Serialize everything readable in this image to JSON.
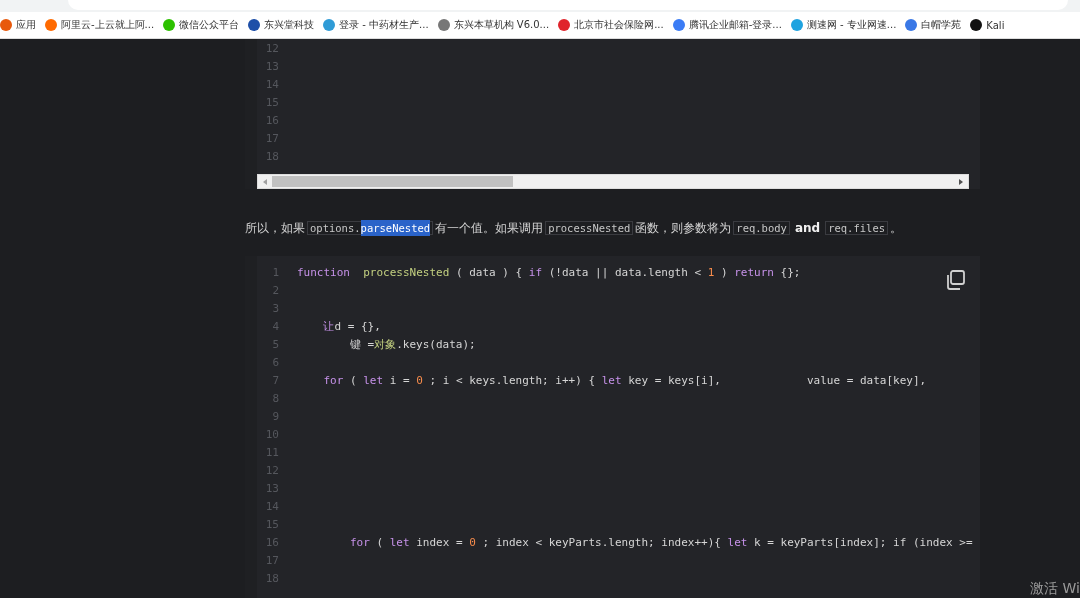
{
  "bookmarks": [
    {
      "label": "应用",
      "color": "#e8590c"
    },
    {
      "label": "阿里云-上云就上阿...",
      "color": "#ff6a00"
    },
    {
      "label": "微信公众平台",
      "color": "#2dc100"
    },
    {
      "label": "东兴堂科技",
      "color": "#1e4fa8"
    },
    {
      "label": "登录 - 中药材生产...",
      "color": "#2f9bd6"
    },
    {
      "label": "东兴本草机构 V6.0...",
      "color": "#777777"
    },
    {
      "label": "北京市社会保险网...",
      "color": "#e0242c"
    },
    {
      "label": "腾讯企业邮箱-登录...",
      "color": "#3b7cf5"
    },
    {
      "label": "测速网 - 专业网速...",
      "color": "#1fa3e0"
    },
    {
      "label": "白帽学苑",
      "color": "#3a78e6"
    },
    {
      "label": "Kali",
      "color": "#111111"
    }
  ],
  "first_code_block": {
    "line_numbers": [
      "12",
      "13",
      "14",
      "15",
      "16",
      "17",
      "18"
    ]
  },
  "paragraph": [
    {
      "kind": "text",
      "text": "所以，如果"
    },
    {
      "kind": "code",
      "parts": [
        {
          "text": "options.",
          "selected": false
        },
        {
          "text": "parseNested",
          "selected": true
        }
      ]
    },
    {
      "kind": "text",
      "text": "有一个值。如果调用"
    },
    {
      "kind": "code",
      "parts": [
        {
          "text": "processNested",
          "selected": false
        }
      ]
    },
    {
      "kind": "text",
      "text": "函数，则参数将为"
    },
    {
      "kind": "code",
      "parts": [
        {
          "text": "req.body",
          "selected": false
        }
      ]
    },
    {
      "kind": "strong",
      "text": "and"
    },
    {
      "kind": "code",
      "parts": [
        {
          "text": "req.files",
          "selected": false
        }
      ]
    },
    {
      "kind": "text",
      "text": "。"
    }
  ],
  "code_block": {
    "lines": [
      {
        "number": "1",
        "tokens": [
          {
            "kind": "keyword",
            "text": "function"
          },
          {
            "kind": "name",
            "text": "  processNested"
          },
          {
            "kind": "plain",
            "text": " ( data ) { "
          },
          {
            "kind": "keyword",
            "text": "if"
          },
          {
            "kind": "plain",
            "text": " (!data || data.length < "
          },
          {
            "kind": "number",
            "text": "1"
          },
          {
            "kind": "plain",
            "text": " ) "
          },
          {
            "kind": "keyword",
            "text": "return"
          },
          {
            "kind": "plain",
            "text": " {};"
          }
        ]
      },
      {
        "number": "2"
      },
      {
        "number": "3"
      },
      {
        "number": "4",
        "tokens": [
          {
            "kind": "keyword",
            "text": "    让"
          },
          {
            "kind": "plain",
            "text": "d = {},"
          }
        ]
      },
      {
        "number": "5",
        "tokens": [
          {
            "kind": "plain",
            "text": "        键 ="
          },
          {
            "kind": "name",
            "text": "对象"
          },
          {
            "kind": "plain",
            "text": ".keys(data);"
          }
        ]
      },
      {
        "number": "6"
      },
      {
        "number": "7",
        "tokens": [
          {
            "kind": "keyword",
            "text": "    for"
          },
          {
            "kind": "plain",
            "text": " ( "
          },
          {
            "kind": "keyword",
            "text": "let"
          },
          {
            "kind": "plain",
            "text": " i = "
          },
          {
            "kind": "number",
            "text": "0"
          },
          {
            "kind": "plain",
            "text": " ; i < keys.length; i++) { "
          },
          {
            "kind": "keyword",
            "text": "let"
          },
          {
            "kind": "plain",
            "text": " key = keys[i],             value = data[key],"
          }
        ]
      },
      {
        "number": "8"
      },
      {
        "number": "9"
      },
      {
        "number": "10"
      },
      {
        "number": "11"
      },
      {
        "number": "12"
      },
      {
        "number": "13"
      },
      {
        "number": "14"
      },
      {
        "number": "15"
      },
      {
        "number": "16",
        "tokens": [
          {
            "kind": "keyword",
            "text": "        for"
          },
          {
            "kind": "plain",
            "text": " ( "
          },
          {
            "kind": "keyword",
            "text": "let"
          },
          {
            "kind": "plain",
            "text": " index = "
          },
          {
            "kind": "number",
            "text": "0"
          },
          {
            "kind": "plain",
            "text": " ; index < keyParts.length; index++){ "
          },
          {
            "kind": "keyword",
            "text": "let"
          },
          {
            "kind": "plain",
            "text": " k = keyParts[index]; if (index >="
          }
        ]
      },
      {
        "number": "17"
      },
      {
        "number": "18"
      }
    ]
  },
  "activation_notice": "激活 Wi"
}
